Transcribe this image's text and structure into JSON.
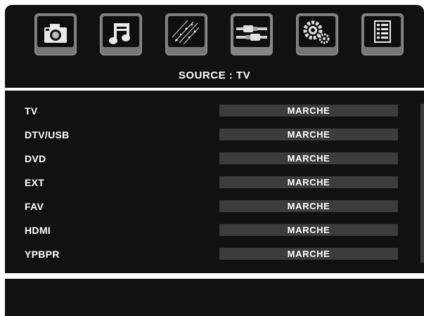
{
  "menu": {
    "icons": [
      {
        "name": "camera-icon",
        "label": "Picture"
      },
      {
        "name": "music-note-icon",
        "label": "Sound"
      },
      {
        "name": "stars-icon",
        "label": "Channel"
      },
      {
        "name": "cables-icon",
        "label": "Source"
      },
      {
        "name": "gears-icon",
        "label": "Setup"
      },
      {
        "name": "document-icon",
        "label": "Info"
      }
    ],
    "selected_index": 3
  },
  "header": {
    "source_label": "SOURCE : TV"
  },
  "sources": [
    {
      "label": "TV",
      "value": "MARCHE"
    },
    {
      "label": "DTV/USB",
      "value": "MARCHE"
    },
    {
      "label": "DVD",
      "value": "MARCHE"
    },
    {
      "label": "EXT",
      "value": "MARCHE"
    },
    {
      "label": "FAV",
      "value": "MARCHE"
    },
    {
      "label": "HDMI",
      "value": "MARCHE"
    },
    {
      "label": "YPBPR",
      "value": "MARCHE"
    }
  ],
  "colors": {
    "panel": "#111111",
    "value_bar": "#3c3c3c",
    "tile": "#767676",
    "text": "#ffffff"
  }
}
